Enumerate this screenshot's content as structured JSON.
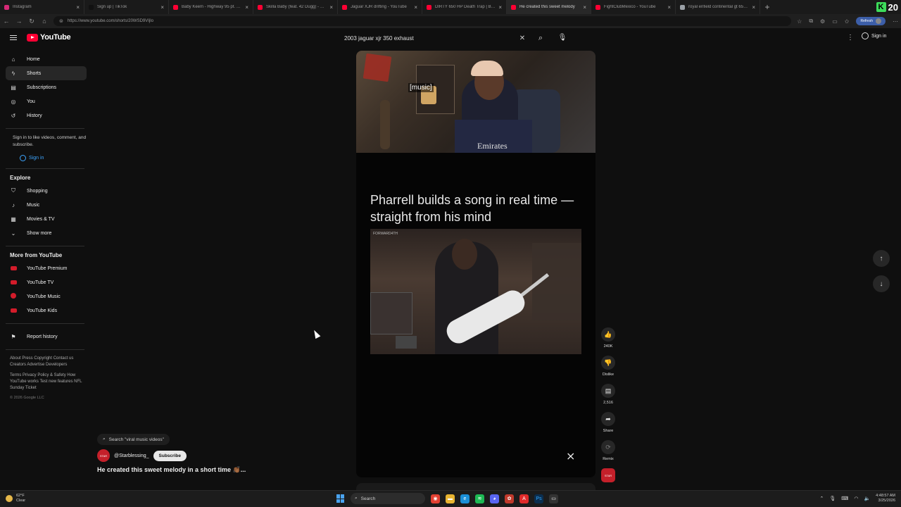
{
  "browser": {
    "tabs": [
      {
        "label": "Instagram",
        "color": "#d62976"
      },
      {
        "label": "Sign up | TikTok",
        "color": "#111111"
      },
      {
        "label": "Baby Keem - Highway 95 pt. 2 (Off",
        "color": "#ff0033"
      },
      {
        "label": "Skilla Baby (feat. 42 Dugg) - West",
        "color": "#ff0033"
      },
      {
        "label": "Jaguar XJR drifting - YouTube",
        "color": "#ff0033"
      },
      {
        "label": "DIRTY 650 HP Death Trap | Big Tur",
        "color": "#ff0033"
      },
      {
        "label": "He created this sweet melody",
        "color": "#ff0033"
      },
      {
        "label": "FightClubMexico - YouTube",
        "color": "#ff0033"
      },
      {
        "label": "royal enfield continental gt 650 b",
        "color": "#9aa0a6"
      }
    ],
    "active_tab_index": 6,
    "url": "https://www.youtube.com/shorts/20WSD9VIjlo",
    "refresh_label": "Refresh",
    "brand_letter": "K",
    "brand_number": "20"
  },
  "header": {
    "logo_text": "YouTube",
    "search_value": "2003 jaguar xjr 350 exhaust",
    "sign_in": "Sign in"
  },
  "sidebar": {
    "main": [
      {
        "label": "Home",
        "icon": "home-icon"
      },
      {
        "label": "Shorts",
        "icon": "shorts-icon"
      },
      {
        "label": "Subscriptions",
        "icon": "subscriptions-icon"
      },
      {
        "label": "You",
        "icon": "you-icon"
      },
      {
        "label": "History",
        "icon": "history-icon"
      }
    ],
    "signin_prompt": "Sign in to like videos, comment, and subscribe.",
    "signin_button": "Sign in",
    "explore_heading": "Explore",
    "explore": [
      {
        "label": "Shopping"
      },
      {
        "label": "Music"
      },
      {
        "label": "Movies & TV"
      },
      {
        "label": "Show more"
      }
    ],
    "more_heading": "More from YouTube",
    "more": [
      {
        "label": "YouTube Premium"
      },
      {
        "label": "YouTube TV"
      },
      {
        "label": "YouTube Music"
      },
      {
        "label": "YouTube Kids"
      }
    ],
    "report": "Report history",
    "footer1": "About  Press  Copyright  Contact us  Creators  Advertise  Developers",
    "footer2": "Terms  Privacy  Policy & Safety  How YouTube works  Test new features  NFL Sunday Ticket",
    "copyright": "© 2026 Google LLC"
  },
  "video": {
    "caption": "[music]",
    "shirt_text": "Emirates",
    "headline": "Pharrell builds a song in real time — straight from his mind",
    "clip_watermark": "FORWARD4TH"
  },
  "actions": {
    "like_count": "240K",
    "dislike_label": "Dislike",
    "comment_count": "2,516",
    "share_label": "Share",
    "remix_label": "Remix",
    "channel_avatar_text": "STAR"
  },
  "meta": {
    "search_chip": "Search \"viral music videos\"",
    "channel": "@Starblessing_",
    "subscribe": "Subscribe",
    "title": "He created this sweet melody in a short time 👏🏾..."
  },
  "taskbar": {
    "temp": "62°F",
    "condition": "Clear",
    "search": "Search",
    "time": "4:48:57 AM",
    "date": "3/25/2026"
  }
}
